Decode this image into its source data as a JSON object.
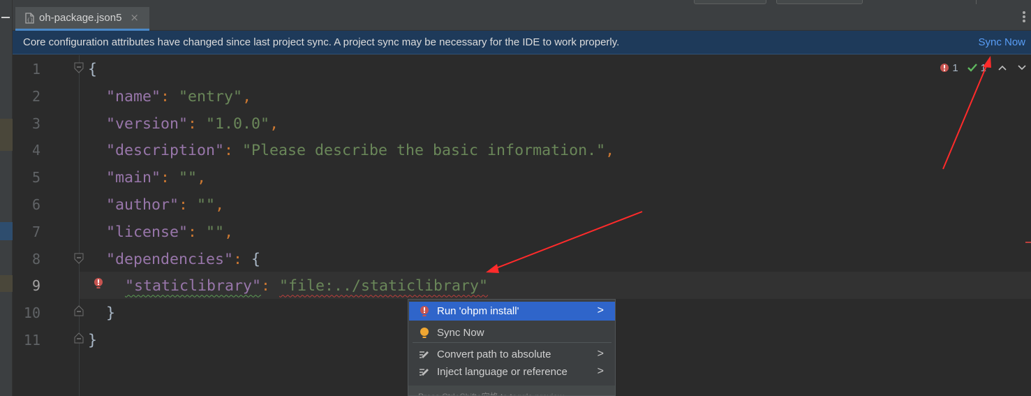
{
  "tab": {
    "title": "oh-package.json5",
    "close_glyph": "×"
  },
  "banner": {
    "message": "Core configuration attributes have changed since last project sync. A project sync may be necessary for the IDE to work properly.",
    "action_label": "Sync Now"
  },
  "inspection": {
    "error_count": "1",
    "ok_count": "1"
  },
  "editor": {
    "active_line": "9",
    "lines": [
      {
        "number": "1",
        "brace": "{"
      },
      {
        "number": "2",
        "key": "\"name\"",
        "value": "\"entry\""
      },
      {
        "number": "3",
        "key": "\"version\"",
        "value": "\"1.0.0\""
      },
      {
        "number": "4",
        "key": "\"description\"",
        "value": "\"Please describe the basic information.\""
      },
      {
        "number": "5",
        "key": "\"main\"",
        "value": "\"\""
      },
      {
        "number": "6",
        "key": "\"author\"",
        "value": "\"\""
      },
      {
        "number": "7",
        "key": "\"license\"",
        "value": "\"\""
      },
      {
        "number": "8",
        "key": "\"dependencies\"",
        "brace": "{"
      },
      {
        "number": "9",
        "key": "\"staticlibrary\"",
        "value": "\"file:../staticlibrary\""
      },
      {
        "number": "10",
        "brace": "}"
      },
      {
        "number": "11",
        "brace": "}"
      }
    ],
    "colon": ":",
    "comma": ","
  },
  "popup": {
    "items": [
      {
        "label": "Run 'ohpm install'",
        "icon": "error-bulb-icon",
        "submenu": true,
        "selected": true
      },
      {
        "label": "Sync Now",
        "icon": "lightbulb-icon",
        "submenu": false,
        "selected": false
      },
      {
        "label": "Convert path to absolute",
        "icon": "pencil-icon",
        "submenu": true,
        "selected": false
      },
      {
        "label": "Inject language or reference",
        "icon": "pencil-icon",
        "submenu": true,
        "selected": false
      }
    ],
    "submenu_glyph": ">",
    "hint": "Press Ctrl+Shift+空格 to toggle preview"
  },
  "colors": {
    "banner_bg": "#1e3a5a",
    "link": "#589df6",
    "selection": "#2f65ca",
    "json_key": "#9876aa",
    "json_string": "#6a8759",
    "punctuation": "#cc7832",
    "error": "#bc3f3c",
    "arrow": "#ff2b2b"
  }
}
